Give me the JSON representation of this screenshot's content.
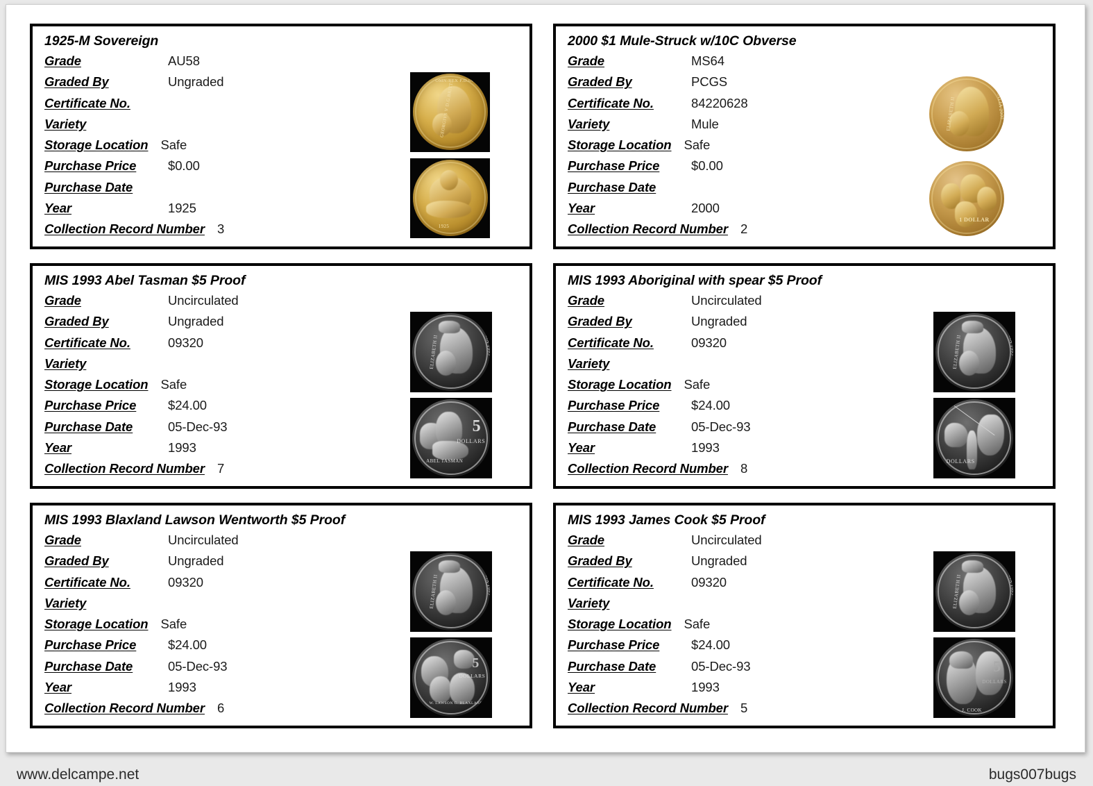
{
  "page": {
    "footer_left": "www.delcampe.net",
    "footer_right": "bugs007bugs",
    "background_color": "#e9e9e9",
    "sheet_color": "#ffffff"
  },
  "field_labels": {
    "grade": "Grade",
    "graded_by": "Graded By",
    "certificate_no": "Certificate No.",
    "variety": "Variety",
    "storage_location": "Storage Location",
    "purchase_price": "Purchase Price",
    "purchase_date": "Purchase Date",
    "year": "Year",
    "collection_record_number": "Collection Record Number"
  },
  "cards": [
    {
      "title": "1925-M Sovereign",
      "grade": "AU58",
      "graded_by": "Ungraded",
      "certificate_no": "",
      "variety": "",
      "storage_location": "Safe",
      "purchase_price": "$0.00",
      "purchase_date": "",
      "year": "1925",
      "collection_record_number": "3",
      "images": {
        "style": "framed-gold",
        "obverse_legend_left": "GEORGIVS V D.G. BRITT: OMN: REX F.D. IND: IMP:",
        "reverse_legend": "1925",
        "obverse_name": "george-v-gold-sovereign-obverse",
        "reverse_name": "st-george-dragon-reverse"
      }
    },
    {
      "title": "2000 $1 Mule-Struck w/10C Obverse",
      "grade": "MS64",
      "graded_by": "PCGS",
      "certificate_no": "84220628",
      "variety": "Mule",
      "storage_location": "Safe",
      "purchase_price": "$0.00",
      "purchase_date": "",
      "year": "2000",
      "collection_record_number": "2",
      "images": {
        "style": "plain-copper",
        "obverse_legend_left": "ELIZABETH II",
        "obverse_legend_right": "AUSTRALIA 2000",
        "reverse_legend": "1 DOLLAR",
        "obverse_name": "elizabeth-ii-dollar-obverse",
        "reverse_name": "kangaroos-one-dollar-reverse"
      }
    },
    {
      "title": "MIS 1993 Abel Tasman $5 Proof",
      "grade": "Uncirculated",
      "graded_by": "Ungraded",
      "certificate_no": "09320",
      "variety": "",
      "storage_location": "Safe",
      "purchase_price": "$24.00",
      "purchase_date": "05-Dec-93",
      "year": "1993",
      "collection_record_number": "7",
      "images": {
        "style": "framed-silver",
        "obverse_legend_left": "ELIZABETH II",
        "obverse_legend_right": "AUSTRALIA 1993",
        "reverse_denom": "5",
        "reverse_denom_word": "DOLLARS",
        "reverse_caption": "ABEL TASMAN",
        "obverse_name": "elizabeth-ii-proof-obverse",
        "reverse_name": "abel-tasman-map-reverse"
      }
    },
    {
      "title": "MIS 1993 Aboriginal with spear $5 Proof",
      "grade": "Uncirculated",
      "graded_by": "Ungraded",
      "certificate_no": "09320",
      "variety": "",
      "storage_location": "Safe",
      "purchase_price": "$24.00",
      "purchase_date": "05-Dec-93",
      "year": "1993",
      "collection_record_number": "8",
      "images": {
        "style": "framed-silver",
        "obverse_legend_left": "ELIZABETH II",
        "obverse_legend_right": "AUSTRALIA 1993",
        "reverse_denom": "",
        "reverse_denom_word": "DOLLARS",
        "reverse_caption": "",
        "obverse_name": "elizabeth-ii-proof-obverse",
        "reverse_name": "aboriginal-with-spear-reverse"
      }
    },
    {
      "title": "MIS 1993 Blaxland Lawson Wentworth $5 Proof",
      "grade": "Uncirculated",
      "graded_by": "Ungraded",
      "certificate_no": "09320",
      "variety": "",
      "storage_location": "Safe",
      "purchase_price": "$24.00",
      "purchase_date": "05-Dec-93",
      "year": "1993",
      "collection_record_number": "6",
      "images": {
        "style": "framed-silver",
        "obverse_legend_left": "ELIZABETH II",
        "obverse_legend_right": "AUSTRALIA 1993",
        "reverse_denom": "",
        "reverse_denom_word": "DOLLARS",
        "reverse_caption": "W. LAWSON G. BLAXLAND W.C. WENTWORTH",
        "obverse_name": "elizabeth-ii-proof-obverse",
        "reverse_name": "blaxland-lawson-wentworth-reverse"
      }
    },
    {
      "title": "MIS 1993 James Cook $5 Proof",
      "grade": "Uncirculated",
      "graded_by": "Ungraded",
      "certificate_no": "09320",
      "variety": "",
      "storage_location": "Safe",
      "purchase_price": "$24.00",
      "purchase_date": "05-Dec-93",
      "year": "1993",
      "collection_record_number": "5",
      "images": {
        "style": "framed-silver",
        "obverse_legend_left": "ELIZABETH II",
        "obverse_legend_right": "AUSTRALIA 1993",
        "reverse_denom": "5",
        "reverse_denom_word": "DOLLARS",
        "reverse_caption": "J. COOK",
        "obverse_name": "elizabeth-ii-proof-obverse",
        "reverse_name": "james-cook-map-reverse"
      }
    }
  ]
}
